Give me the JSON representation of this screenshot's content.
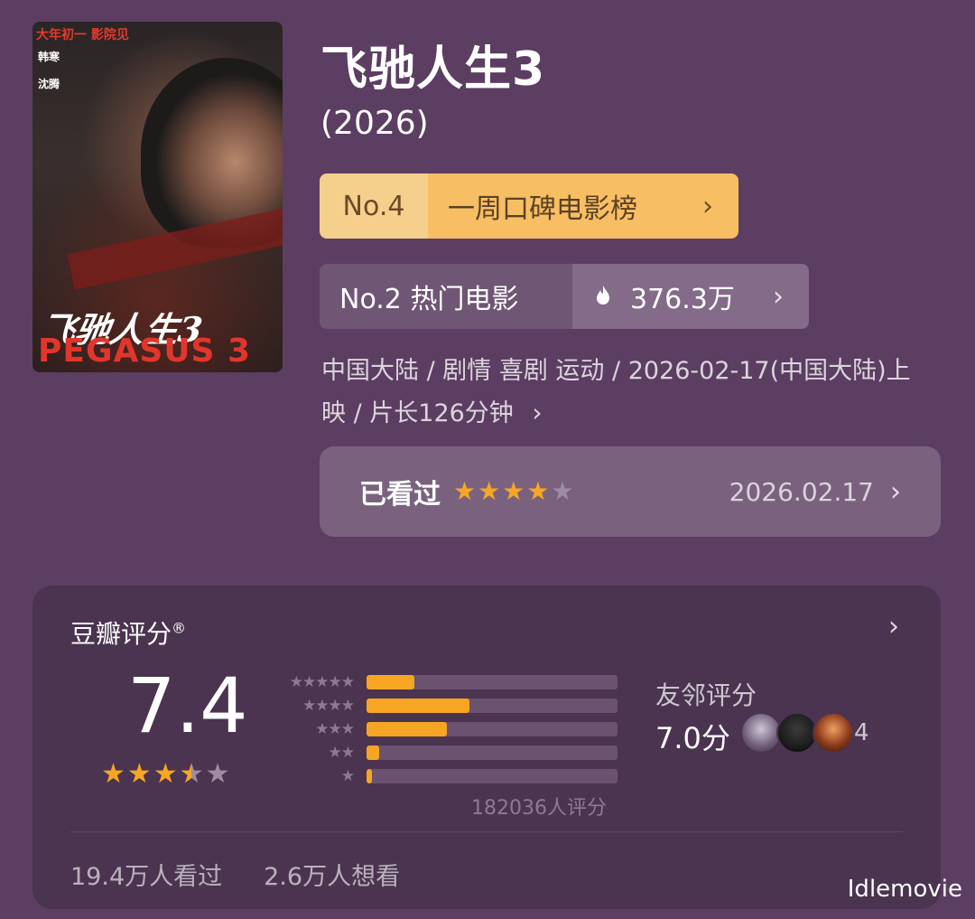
{
  "poster": {
    "tag": "大年初一 影院见",
    "cast1": "韩寒",
    "cast2": "沈腾",
    "cn_title": "飞驰人生3",
    "en_title": "PEGASUS 3"
  },
  "movie": {
    "title": "飞驰人生3",
    "year": "(2026)",
    "meta": "中国大陆 / 剧情 喜剧 运动 / 2026-02-17(中国大陆)上映 / 片长126分钟"
  },
  "rank_weekly": {
    "no": "No.4",
    "label": "一周口碑电影榜"
  },
  "rank_hot": {
    "label": "No.2 热门电影",
    "heat": "376.3万"
  },
  "watched": {
    "label": "已看过",
    "rating_stars": 4,
    "date": "2026.02.17"
  },
  "rating": {
    "header": "豆瓣评分",
    "mark": "®",
    "score": "7.4",
    "stars": 3.5,
    "distribution": [
      {
        "stars": "★★★★★",
        "percent": 19
      },
      {
        "stars": "★★★★",
        "percent": 41
      },
      {
        "stars": "★★★",
        "percent": 32
      },
      {
        "stars": "★★",
        "percent": 5
      },
      {
        "stars": "★",
        "percent": 2
      }
    ],
    "count": "182036人评分",
    "neighbors_label": "友邻评分",
    "neighbors_score": "7.0分",
    "neighbors_count": "4",
    "watched_count": "19.4万人看过",
    "want_count": "2.6万人想看"
  },
  "colors": {
    "accent": "#f6a623",
    "background": "#5c3e62",
    "card": "#4b3450"
  },
  "icons": {
    "flame": "flame-icon",
    "chevron": "chevron-right-icon"
  },
  "watermark": "Idlemovie"
}
